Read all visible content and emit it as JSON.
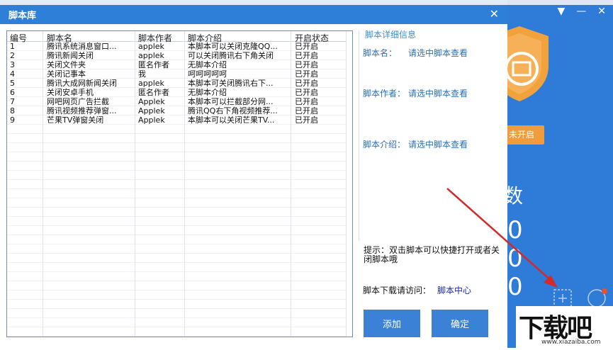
{
  "dialog": {
    "title": "脚本库",
    "close_glyph": "✕"
  },
  "table": {
    "columns": [
      "编号",
      "脚本名",
      "脚本作者",
      "脚本介绍",
      "开启状态"
    ],
    "rows": [
      [
        "1",
        "腾讯系统消息窗口...",
        "applek",
        "本脚本可以关闭克隆QQ...",
        "已开启"
      ],
      [
        "2",
        "腾讯新闻关闭",
        "applek",
        "可以关闭腾讯右下角关闭",
        "已开启"
      ],
      [
        "3",
        "关闭文件夹",
        "匿名作者",
        "无脚本介绍",
        "已开启"
      ],
      [
        "4",
        "关闭记事本",
        "我",
        "呵呵呵呵呵",
        "已开启"
      ],
      [
        "5",
        "腾讯大成网新闻关闭",
        "applek",
        "本脚本可关闭腾讯右下...",
        "已开启"
      ],
      [
        "6",
        "关闭安卓手机",
        "匿名作者",
        "无脚本介绍",
        "已开启"
      ],
      [
        "7",
        "网吧网页广告拦截",
        "Applek",
        "本脚本可以拦截部分网...",
        "已开启"
      ],
      [
        "8",
        "腾讯视频推荐弹窗...",
        "Applek",
        "腾讯QQ右下角视频推荐...",
        "已开启"
      ],
      [
        "9",
        "芒果TV弹窗关闭",
        "Applek",
        "本脚本可以关闭芒果TV...",
        "已开启"
      ]
    ]
  },
  "detail": {
    "header": "脚本详细信息",
    "name_label": "脚本名：",
    "name_value": "请选中脚本查看",
    "author_label": "脚本作者：",
    "author_value": "请选中脚本查看",
    "intro_label": "脚本介绍：",
    "intro_value": "请选中脚本查看"
  },
  "hint": "提示：双击脚本可以快捷打开或者关闭脚本哦",
  "download": {
    "label": "脚本下载请访问：",
    "link": "脚本中心"
  },
  "buttons": {
    "add": "添加",
    "ok": "确定"
  },
  "background_app": {
    "start_label": "未开启",
    "stat_char": "数",
    "counters": "0 0 0",
    "window_controls": [
      "▼",
      "—",
      "✕"
    ]
  },
  "watermark": {
    "brand": "下载吧",
    "url": "www.xiazaiba.com"
  },
  "colors": {
    "titlebar": "#2e7fd8",
    "accent": "#3b82d6",
    "bg_app": "#2f7bd8",
    "arrow": "#d42a2a",
    "orange": "#f19b3a"
  }
}
